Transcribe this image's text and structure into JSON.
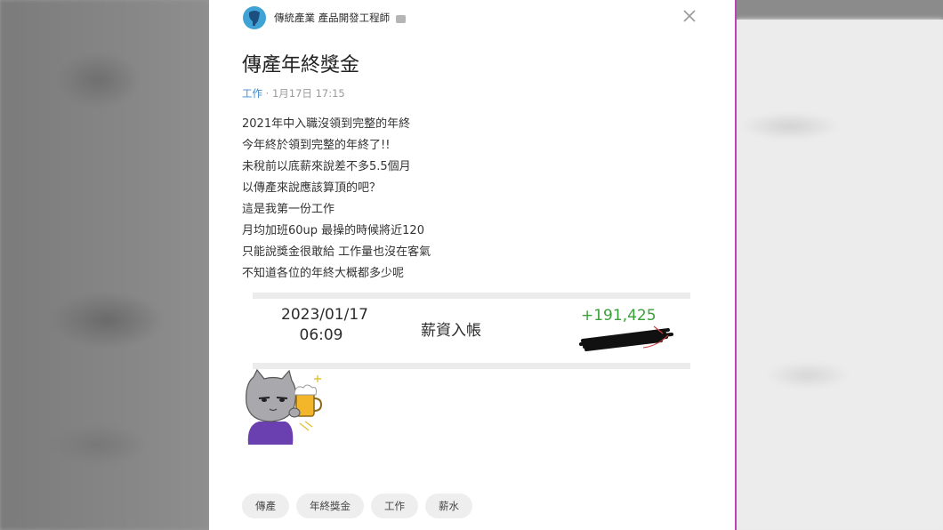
{
  "post": {
    "author": "傳統產業 產品開發工程師",
    "title": "傳產年終獎金",
    "category": "工作",
    "separator": "·",
    "timestamp": "1月17日 17:15",
    "body_lines": [
      "2021年中入職沒領到完整的年終",
      "今年終於領到完整的年終了!!",
      "未稅前以底薪來說差不多5.5個月",
      "以傳產來說應該算頂的吧？",
      "這是我第一份工作",
      "月均加班60up 最操的時候將近120",
      "只能說獎金很敢給 工作量也沒在客氣",
      "不知道各位的年終大概都多少呢"
    ],
    "bank_record": {
      "date": "2023/01/17",
      "time": "06:09",
      "label": "薪資入帳",
      "amount": "+191,425"
    },
    "tags": [
      "傳產",
      "年終獎金",
      "工作",
      "薪水"
    ]
  },
  "icons": {
    "avatar": "anonymous-avatar-icon",
    "badge": "verified-badge-icon",
    "close": "close-icon",
    "sticker": "cat-beer-sticker"
  },
  "colors": {
    "category": "#3c8cd1",
    "amount": "#3aa03a",
    "avatar": "#3fa3d6",
    "divider": "#c23fb8"
  }
}
